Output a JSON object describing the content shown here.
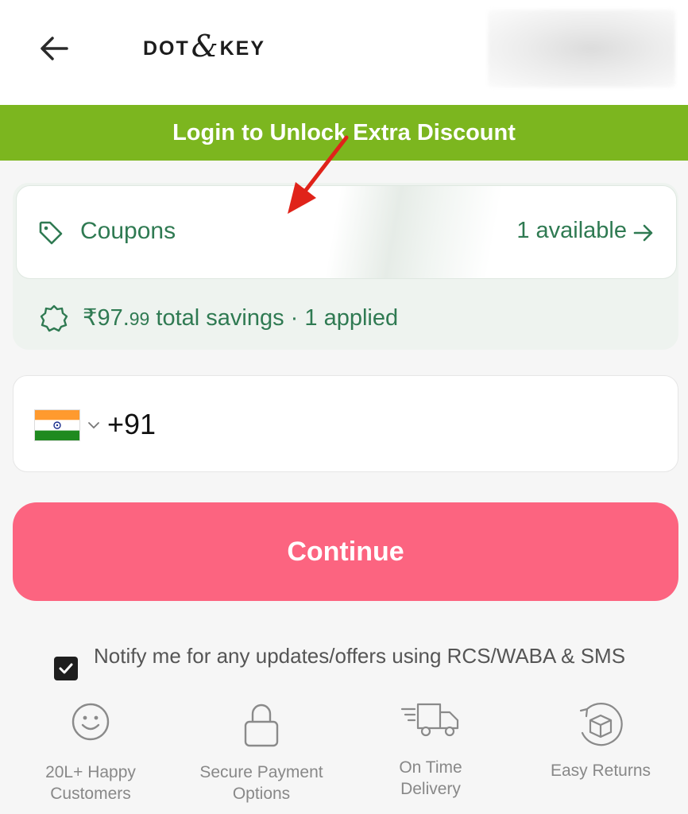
{
  "header": {
    "back_icon": "arrow-left-icon",
    "logo": {
      "left": "DOT",
      "amp": "&",
      "right": "KEY"
    }
  },
  "banner": {
    "text": "Login to Unlock Extra Discount",
    "bg_color": "#7cb61f"
  },
  "coupons": {
    "icon": "tag-icon",
    "label": "Coupons",
    "available": "1 available",
    "arrow_icon": "arrow-right-icon",
    "accent_color": "#2f7a52"
  },
  "savings": {
    "icon": "badge-icon",
    "amount_main": "₹97.",
    "amount_paise": "99",
    "suffix": " total savings · 1 applied"
  },
  "phone": {
    "country_flag": "india-flag-icon",
    "dropdown_icon": "chevron-down-icon",
    "value": "+91"
  },
  "continue": {
    "label": "Continue",
    "bg_color": "#fc6480"
  },
  "notify": {
    "checked": true,
    "text": "Notify me for any updates/offers using RCS/WABA & SMS"
  },
  "features": [
    {
      "icon": "smiley-icon",
      "line1": "20L+ Happy",
      "line2": "Customers"
    },
    {
      "icon": "lock-icon",
      "line1": "Secure Payment",
      "line2": "Options"
    },
    {
      "icon": "truck-icon",
      "line1": "On Time",
      "line2": "Delivery"
    },
    {
      "icon": "returns-box-icon",
      "line1": "Easy Returns",
      "line2": ""
    }
  ]
}
